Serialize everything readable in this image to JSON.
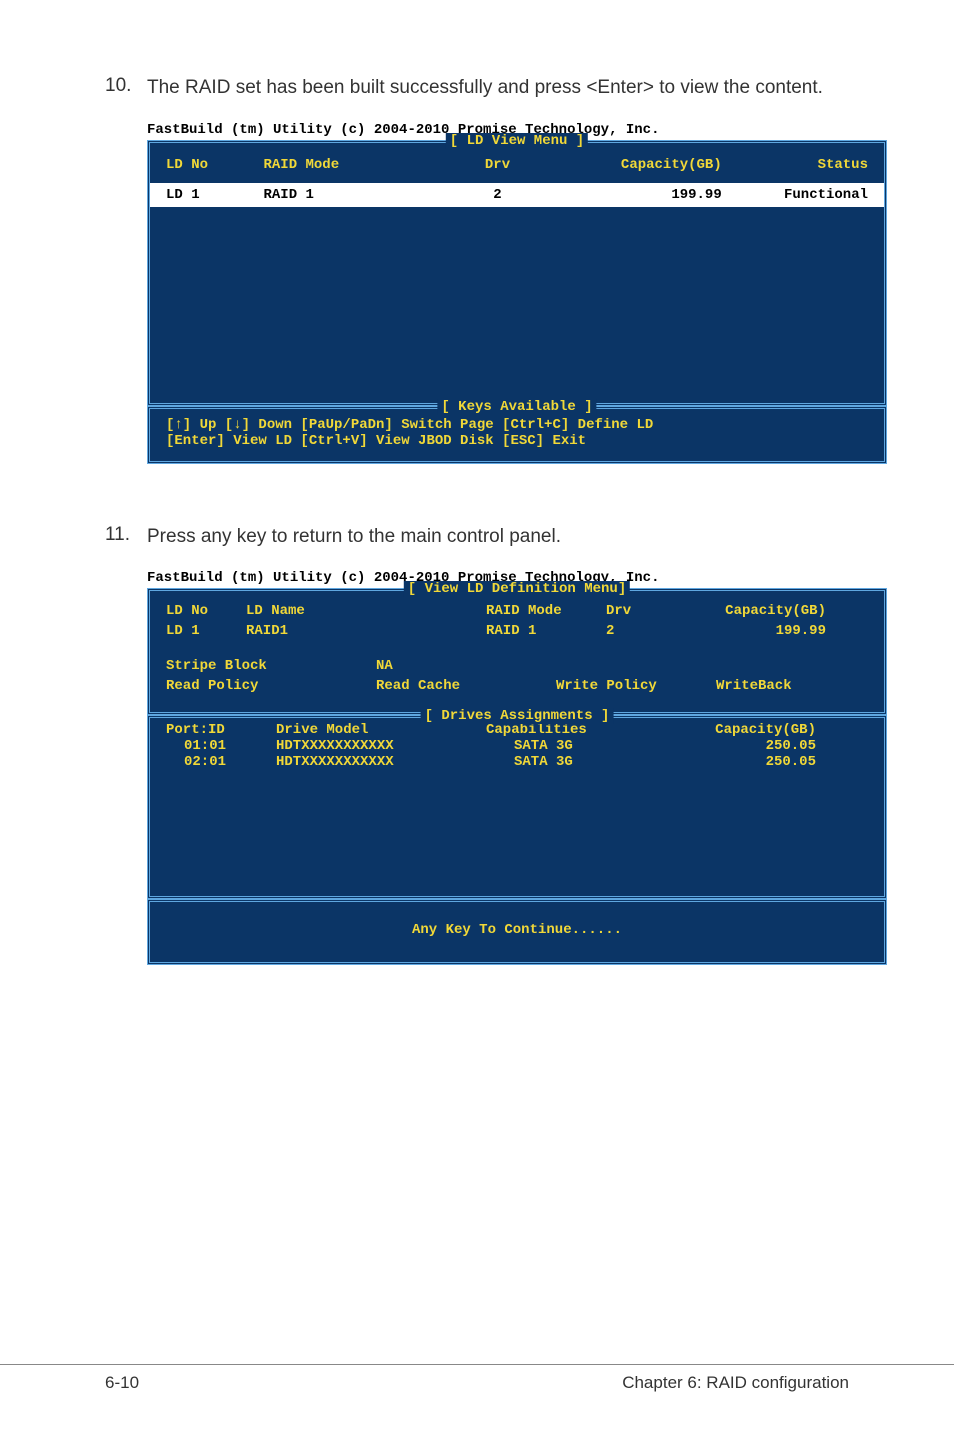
{
  "step10": {
    "num": "10.",
    "text": "The RAID set has been built successfully and press <Enter> to view the content."
  },
  "step11": {
    "num": "11.",
    "text": "Press any key to return to the main control panel."
  },
  "bios": {
    "title": "FastBuild (tm) Utility (c) 2004-2010 Promise Technology, Inc.",
    "screen1": {
      "frame_title": "[ LD View Menu ]",
      "header": {
        "ld_no": "LD No",
        "raid_mode": "RAID Mode",
        "drv": "Drv",
        "capacity": "Capacity(GB)",
        "status": "Status"
      },
      "row": {
        "ld_no": "LD  1",
        "raid_mode": "RAID 1",
        "drv": "2",
        "capacity": "199.99",
        "status": "Functional"
      },
      "keys_title": "[ Keys Available ]",
      "keys_line1": "[↑] Up  [↓] Down  [PaUp/PaDn] Switch Page  [Ctrl+C] Define LD",
      "keys_line2": "[Enter] View LD  [Ctrl+V] View JBOD Disk  [ESC] Exit"
    },
    "screen2": {
      "frame_title": "[ View LD Definition Menu]",
      "ld_no_label": "LD No",
      "ld_name_label": "LD Name",
      "raid_mode_label": "RAID Mode",
      "drv_label": "Drv",
      "capacity_label": "Capacity(GB)",
      "ld_no": "LD  1",
      "ld_name": "RAID1",
      "raid_mode": "RAID 1",
      "drv": "2",
      "capacity": "199.99",
      "stripe_label": "Stripe Block",
      "stripe_val": "NA",
      "read_policy_label": "Read Policy",
      "read_cache": "Read Cache",
      "write_policy_label": "Write Policy",
      "writeback": "WriteBack",
      "drives_title": "[ Drives Assignments ]",
      "drives_header": {
        "port": "Port:ID",
        "model": "Drive Model",
        "cap": "Capabilities",
        "capacity": "Capacity(GB)"
      },
      "drives": [
        {
          "port": "01:01",
          "model": "HDTXXXXXXXXXXX",
          "cap": "SATA 3G",
          "capacity": "250.05"
        },
        {
          "port": "02:01",
          "model": "HDTXXXXXXXXXXX",
          "cap": "SATA 3G",
          "capacity": "250.05"
        }
      ],
      "continue": "Any Key To Continue......"
    }
  },
  "footer": {
    "left": "6-10",
    "right": "Chapter 6: RAID configuration"
  }
}
